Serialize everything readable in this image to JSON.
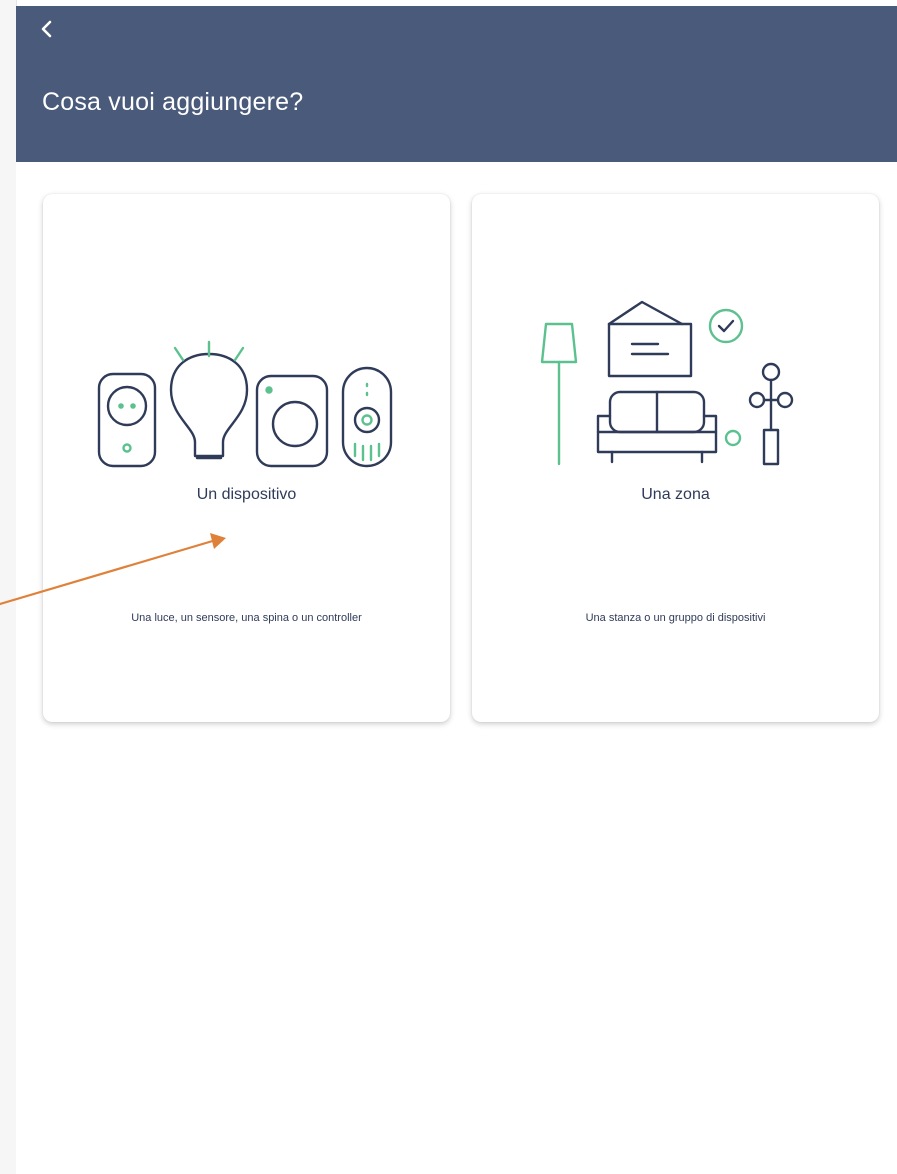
{
  "header": {
    "title": "Cosa vuoi aggiungere?",
    "back_icon": "chevron-left-icon",
    "background": "#4a5a7b"
  },
  "options": [
    {
      "title": "Un dispositivo",
      "subtitle": "Una luce, un sensore, una spina o un controller",
      "illustration": "devices-illustration"
    },
    {
      "title": "Una zona",
      "subtitle": "Una stanza o un gruppo di dispositivi",
      "illustration": "room-illustration"
    }
  ],
  "colors": {
    "accent_green": "#5cc18f",
    "line_navy": "#2f3b59",
    "annotation_arrow": "#e0813a"
  }
}
